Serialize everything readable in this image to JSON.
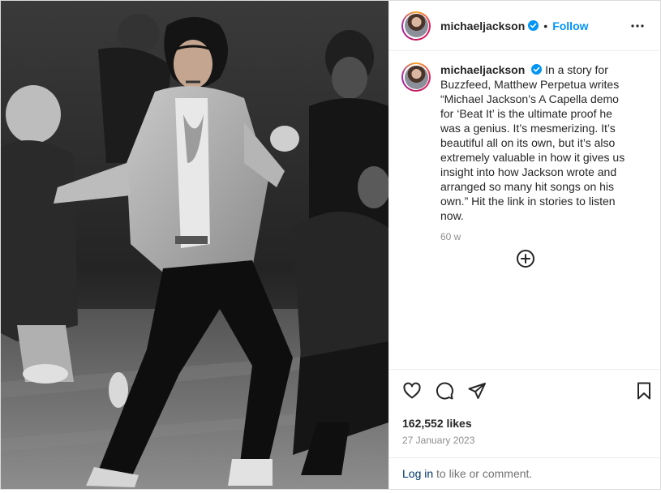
{
  "post": {
    "username": "michaeljackson",
    "follow_label": "Follow",
    "separator": "•",
    "verified_color": "#0095f6",
    "caption": "In a story for Buzzfeed, Matthew Perpetua writes “Michael Jackson’s A Capella demo for ‘Beat It’ is the ultimate proof he was a genius. It’s mesmerizing. It’s beautiful all on its own, but it’s also extremely valuable in how it gives us insight into how Jackson wrote and arranged so many hit songs on his own.” Hit the link in stories to listen now.",
    "time_ago": "60 w",
    "likes": "162,552 likes",
    "date": "27 January 2023"
  },
  "footer": {
    "login_link": "Log in",
    "login_rest": " to like or comment."
  },
  "icons": {
    "more": "more-options-icon",
    "load_more": "plus-circle-icon",
    "like": "heart-icon",
    "comment": "comment-icon",
    "share": "share-icon",
    "save": "bookmark-icon",
    "verified": "verified-badge-icon"
  }
}
